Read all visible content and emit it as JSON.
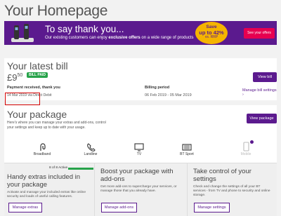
{
  "page": {
    "title": "Your Homepage"
  },
  "banner": {
    "headline": "To say thank you...",
    "subline_prefix": "Our existing customers can enjoy",
    "subline_bold": "exclusive offers",
    "subline_suffix": "on a wide range of products",
    "badge_line1": "Save",
    "badge_line2": "up to 42%",
    "badge_line3": "vs. RRP",
    "cta_label": "See your offers",
    "colors": {
      "background": "#5b1a8e",
      "badge": "#f5b400",
      "cta": "#e60050"
    }
  },
  "bill": {
    "title": "Your latest bill",
    "currency": "£",
    "amount_whole": "9",
    "amount_pence": "50",
    "status_badge": "BILL PAID",
    "view_button": "View bill",
    "payment_label": "Payment received, thank you",
    "payment_detail": "14 Mar 2019 via Direct Debit",
    "period_label": "Billing period",
    "period_value": "06 Feb 2019 - 05 Mar 2019",
    "manage_link": "Manage bill settings ›"
  },
  "package": {
    "title": "Your package",
    "description": "Here's where you can manage your extras and add-ons, control your settings and keep up to date with your usage.",
    "view_button": "View package",
    "services": [
      {
        "label": "Broadband",
        "icon": "broadband-icon",
        "active": true
      },
      {
        "label": "Landline",
        "icon": "landline-phone-icon",
        "active": true
      },
      {
        "label": "TV",
        "icon": "tv-icon",
        "active": true
      },
      {
        "label": "BT Sport",
        "icon": "bt-sport-icon",
        "active": true
      },
      {
        "label": "Mobile",
        "icon": "mobile-phone-icon",
        "active": false
      }
    ],
    "extras": {
      "title": "Handy extras included in your package",
      "active_count": "8 of 8 Active",
      "progress_fraction": 1.0,
      "description": "Activate and manage your included extras like online security and loads of useful calling features.",
      "button": "Manage extras"
    },
    "addons": {
      "title": "Boost your package with add-ons",
      "description": "Get more add-ons to supercharge your services, or manage those that you already have.",
      "button": "Manage add-ons"
    },
    "settings": {
      "title": "Take control of your settings",
      "description": "Check and change the settings of all your BT services - from TV and phone to security and online storage.",
      "button": "Manage settings"
    }
  }
}
